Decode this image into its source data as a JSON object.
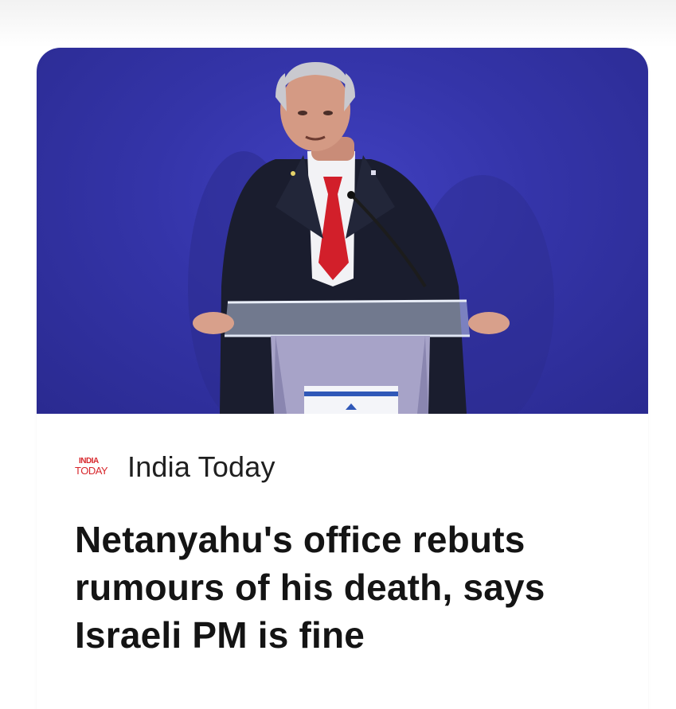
{
  "article": {
    "image_alt": "Man in dark suit and red tie speaking at a clear podium with an Israeli flag",
    "source": {
      "logo_line1": "INDIA",
      "logo_line2": "TODAY",
      "name": "India Today"
    },
    "headline": "Netanyahu's office rebuts rumours of his death, says Israeli PM is fine"
  },
  "colors": {
    "background_top": "#f2f2f2",
    "card": "#ffffff",
    "hero_blue": "#3434a8",
    "logo_red": "#d7262b",
    "headline_text": "#141414"
  }
}
